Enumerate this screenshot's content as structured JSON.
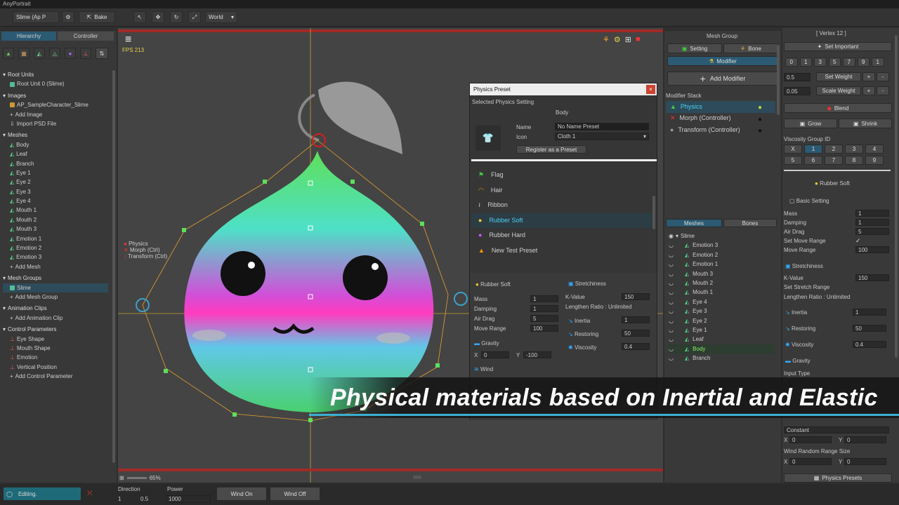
{
  "app": {
    "title": "AnyPortrait"
  },
  "toolbar": {
    "portrait_name": "Slime (Ap P",
    "bake_label": "Bake",
    "space_label": "World"
  },
  "left": {
    "tabs": [
      "Hierarchy",
      "Controller"
    ],
    "sections": [
      {
        "title": "Root Units",
        "items": [
          "Root Unit 0 (Slime)"
        ]
      },
      {
        "title": "Images",
        "items": [
          "AP_SampleCharacter_Slime",
          "Add Image",
          "Import PSD File"
        ]
      },
      {
        "title": "Meshes",
        "items": [
          "Body",
          "Leaf",
          "Branch",
          "Eye 1",
          "Eye 2",
          "Eye 3",
          "Eye 4",
          "Mouth 1",
          "Mouth 2",
          "Mouth 3",
          "Emotion 1",
          "Emotion 2",
          "Emotion 3",
          "Add Mesh"
        ]
      },
      {
        "title": "Mesh Groups",
        "items": [
          "Slime",
          "Add Mesh Group"
        ]
      },
      {
        "title": "Animation Clips",
        "items": [
          "Add Animation Clip"
        ]
      },
      {
        "title": "Control Parameters",
        "items": [
          "Eye Shape",
          "Mouth Shape",
          "Emotion",
          "Vertical Position",
          "Add Control Parameter"
        ]
      }
    ],
    "editing_label": "Editing."
  },
  "viewport": {
    "fps": "FPS 213",
    "zoom": "65%",
    "overlay_items": [
      "Physics",
      "Morph (Ctrl)",
      "Transform (Ctrl)"
    ],
    "caption": "Physical materials based on Inertial and Elastic"
  },
  "bottom": {
    "direction_label": "Direction",
    "direction_x": "1",
    "direction_y": "0.5",
    "power_label": "Power",
    "power_value": "1000",
    "wind_on": "Wind On",
    "wind_off": "Wind Off"
  },
  "physics_preset": {
    "title": "Physics Preset",
    "selected_label": "Selected Physics Setting",
    "body_label": "Body",
    "name_label": "Name",
    "name_value": "No Name Preset",
    "icon_label": "Icon",
    "icon_value": "Cloth 1",
    "register_label": "Register as a Preset",
    "presets": [
      "Flag",
      "Hair",
      "Ribbon",
      "Rubber Soft",
      "Rubber Hard",
      "New Test Preset"
    ],
    "detail": {
      "title": "Rubber Soft",
      "mass_label": "Mass",
      "mass": "1",
      "damping_label": "Damping",
      "damping": "1",
      "airdrag_label": "Air Drag",
      "airdrag": "5",
      "moverange_label": "Move Range",
      "moverange": "100",
      "gravity_label": "Gravity",
      "gravity_x": "0",
      "gravity_y": "-100",
      "wind_label": "Wind",
      "stretch_label": "Stretchiness",
      "kvalue_label": "K-Value",
      "kvalue": "150",
      "lengthen": "Lengthen Ratio : Unlimited",
      "inertia_label": "Inertia",
      "inertia": "1",
      "restoring_label": "Restoring",
      "restoring": "50",
      "viscosity_label": "Viscosity",
      "viscosity": "0.4"
    }
  },
  "mesh_group": {
    "title": "Mesh Group",
    "setting_label": "Setting",
    "bone_label": "Bone",
    "modifier_label": "Modifier",
    "add_modifier": "Add Modifier",
    "stack_label": "Modifier Stack",
    "stack": [
      "Physics",
      "Morph (Controller)",
      "Transform (Controller)"
    ],
    "tabs": [
      "Meshes",
      "Bones"
    ],
    "root": "Slime",
    "meshes": [
      "Emotion 3",
      "Emotion 2",
      "Emotion 1",
      "Mouth 3",
      "Mouth 2",
      "Mouth 1",
      "Eye 4",
      "Eye 3",
      "Eye 2",
      "Eye 1",
      "Leaf",
      "Body",
      "Branch"
    ]
  },
  "right": {
    "vertex_title": "[ Vertex 12 ]",
    "set_important": "Set Important",
    "num_row": [
      "0",
      "1",
      "3",
      "5",
      "7",
      "9",
      "1"
    ],
    "weight_value": "0.5",
    "set_weight": "Set Weight",
    "scale_value": "0.05",
    "scale_weight": "Scale Weight",
    "blend": "Blend",
    "grow": "Grow",
    "shrink": "Shrink",
    "viscosity_group_label": "Viscosity Group ID",
    "vg_row1": [
      "X",
      "1",
      "2",
      "3",
      "4"
    ],
    "vg_row2": [
      "5",
      "6",
      "7",
      "8",
      "9"
    ],
    "preset_name": "Rubber Soft",
    "basic_setting": "Basic Setting",
    "mass_label": "Mass",
    "mass": "1",
    "damping_label": "Damping",
    "damping": "1",
    "airdrag_label": "Air Drag",
    "airdrag": "5",
    "set_move_range": "Set Move Range",
    "move_range_label": "Move Range",
    "move_range": "100",
    "stretch_label": "Stretchiness",
    "kvalue_label": "K-Value",
    "kvalue": "150",
    "set_stretch": "Set Stretch Range",
    "lengthen": "Lengthen Ratio : Unlimited",
    "inertia_label": "Inertia",
    "inertia": "1",
    "restoring_label": "Restoring",
    "restoring": "50",
    "viscosity_label": "Viscosity",
    "viscosity": "0.4",
    "gravity_label": "Gravity",
    "input_type": "Input Type",
    "constant": "Constant",
    "x_label": "X",
    "y_label": "Y",
    "x_val": "0",
    "y_val": "0",
    "wind_random": "Wind Random Range Size",
    "wx": "0",
    "wy": "0",
    "physics_presets": "Physics Presets"
  },
  "colors": {
    "accent": "#3aa0c8",
    "bar_red": "#c0302a",
    "caption_line": "#3ab0d0"
  }
}
